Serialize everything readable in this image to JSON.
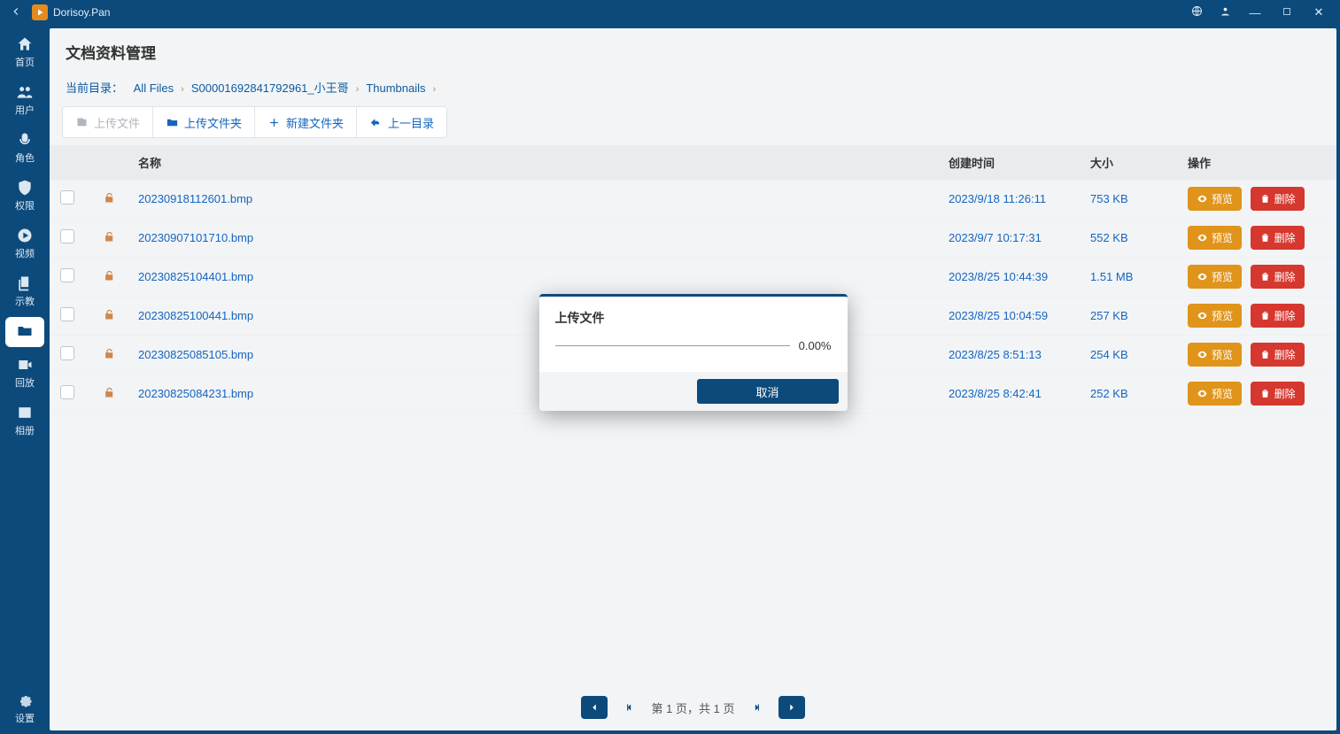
{
  "titlebar": {
    "app_name": "Dorisoy.Pan"
  },
  "sidebar": {
    "items": [
      {
        "label": "首页",
        "icon": "home"
      },
      {
        "label": "用户",
        "icon": "users"
      },
      {
        "label": "角色",
        "icon": "voice"
      },
      {
        "label": "权限",
        "icon": "shield"
      },
      {
        "label": "视频",
        "icon": "play"
      },
      {
        "label": "示教",
        "icon": "copy"
      },
      {
        "label": "",
        "icon": "folder",
        "active": true
      },
      {
        "label": "回放",
        "icon": "video"
      },
      {
        "label": "相册",
        "icon": "image"
      }
    ],
    "settings_label": "设置"
  },
  "page": {
    "title": "文档资料管理"
  },
  "breadcrumb": {
    "label": "当前目录：",
    "items": [
      "All Files",
      "S00001692841792961_小王哥",
      "Thumbnails"
    ]
  },
  "toolbar": {
    "upload_file": "上传文件",
    "upload_folder": "上传文件夹",
    "new_folder": "新建文件夹",
    "up_dir": "上一目录"
  },
  "table": {
    "headers": {
      "name": "名称",
      "created": "创建时间",
      "size": "大小",
      "ops": "操作"
    },
    "preview_label": "预览",
    "delete_label": "删除",
    "rows": [
      {
        "name": "20230918112601.bmp",
        "created": "2023/9/18 11:26:11",
        "size": "753 KB"
      },
      {
        "name": "20230907101710.bmp",
        "created": "2023/9/7 10:17:31",
        "size": "552 KB"
      },
      {
        "name": "20230825104401.bmp",
        "created": "2023/8/25 10:44:39",
        "size": "1.51 MB"
      },
      {
        "name": "20230825100441.bmp",
        "created": "2023/8/25 10:04:59",
        "size": "257 KB"
      },
      {
        "name": "20230825085105.bmp",
        "created": "2023/8/25 8:51:13",
        "size": "254 KB"
      },
      {
        "name": "20230825084231.bmp",
        "created": "2023/8/25 8:42:41",
        "size": "252 KB"
      }
    ]
  },
  "pager": {
    "text": "第 1 页，共 1 页"
  },
  "modal": {
    "title": "上传文件",
    "progress_text": "0.00%",
    "progress_value": 0,
    "cancel": "取消"
  }
}
